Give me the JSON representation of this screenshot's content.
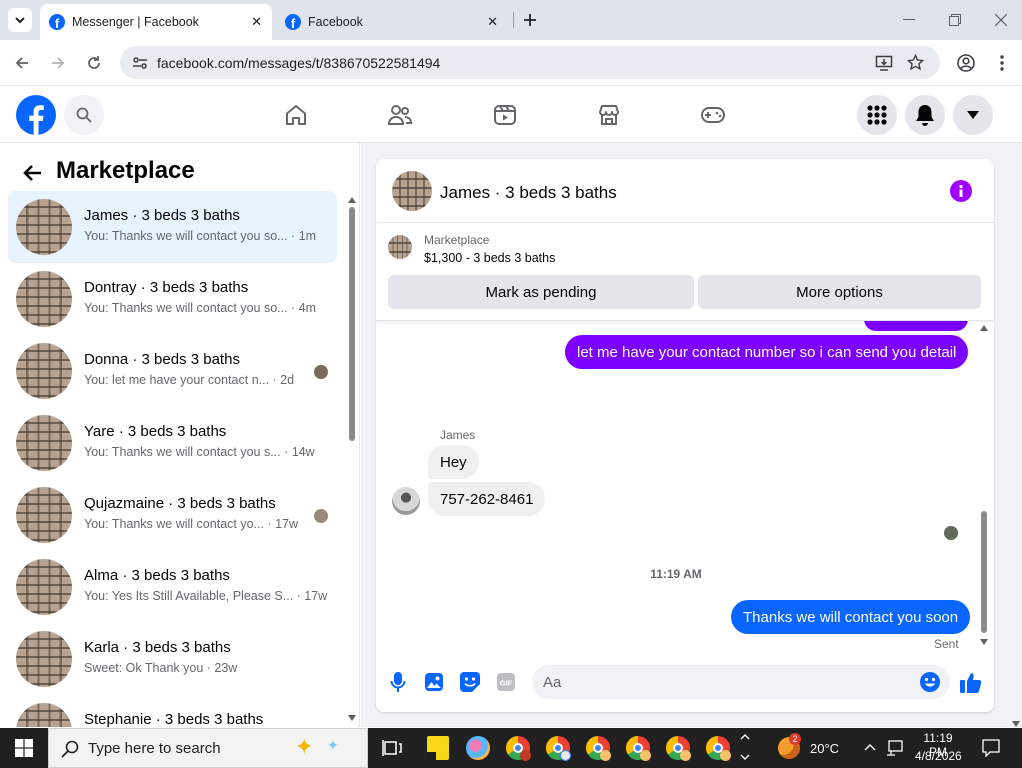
{
  "browser": {
    "tabs": [
      {
        "title": "Messenger | Facebook",
        "active": true
      },
      {
        "title": "Facebook",
        "active": false
      }
    ],
    "url": "facebook.com/messages/t/838670522581494"
  },
  "colors": {
    "fb_blue": "#0866ff",
    "purple": "#7b00ff",
    "selected_row": "#e7f3ff"
  },
  "marketplace": {
    "title": "Marketplace",
    "conversations": [
      {
        "name": "James · 3 beds 3 baths",
        "preview": "You: Thanks we will contact you so... · 1m",
        "selected": true
      },
      {
        "name": "Dontray · 3 beds 3 baths",
        "preview": "You: Thanks we will contact you so... · 4m"
      },
      {
        "name": "Donna · 3 beds 3 baths",
        "preview": "You: let me have your contact n... · 2d"
      },
      {
        "name": "Yare · 3 beds 3 baths",
        "preview": "You: Thanks we will contact you s... · 14w"
      },
      {
        "name": "Qujazmaine · 3 beds 3 baths",
        "preview": "You: Thanks we will contact yo... · 17w"
      },
      {
        "name": "Alma · 3 beds 3 baths",
        "preview": "You: Yes Its Still Available, Please S... · 17w"
      },
      {
        "name": "Karla · 3 beds 3 baths",
        "preview": "Sweet: Ok Thank you · 23w"
      },
      {
        "name": "Stephanie · 3 beds 3 baths",
        "preview": ""
      }
    ]
  },
  "chat": {
    "title": "James · 3 beds 3 baths",
    "listing_source": "Marketplace",
    "listing_title": "$1,300 - 3 beds 3 baths",
    "mark_pending": "Mark as pending",
    "more_options": "More options",
    "messages": {
      "out1": "let me have your contact number so i can send you detail",
      "sender": "James",
      "in1": "Hey",
      "in2": "757-262-8461",
      "time": "11:19 AM",
      "out2": "Thanks we will contact you soon",
      "status": "Sent"
    },
    "composer_placeholder": "Aa"
  },
  "taskbar": {
    "search_placeholder": "Type here to search",
    "weather": "20°C",
    "weather_badge": "2",
    "time": "11:19 PM",
    "date": "4/8/2026"
  }
}
